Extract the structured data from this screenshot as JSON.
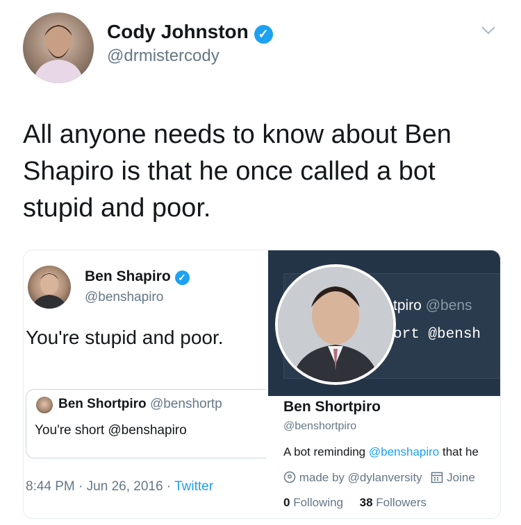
{
  "author": {
    "name": "Cody Johnston",
    "handle": "@drmistercody",
    "verified_icon": "verified-badge-icon"
  },
  "tweet": {
    "text": "All anyone needs to know about Ben Shapiro is that he once called a bot stupid and poor."
  },
  "embedded_tweet": {
    "name": "Ben Shapiro",
    "handle": "@benshapiro",
    "text": "You're stupid and poor.",
    "quoted": {
      "name": "Ben Shortpiro",
      "handle": "@benshortp",
      "text": "You're short @benshapiro"
    },
    "time": "8:44 PM",
    "date": "Jun 26, 2016",
    "source": "Twitter",
    "sep": " · "
  },
  "profile": {
    "banner_line1_name": "tpiro",
    "banner_line1_handle": "@bens",
    "banner_line2_name": "ort",
    "banner_line2_handle": "@bensh",
    "name": "Ben Shortpiro",
    "handle": "@benshortpiro",
    "bio_prefix": "A bot reminding ",
    "bio_link": "@benshapiro",
    "bio_suffix": " that he",
    "location": "made by @dylanversity",
    "joined": "Joine",
    "following_count": "0",
    "following_label": "Following",
    "followers_count": "38",
    "followers_label": "Followers"
  },
  "colors": {
    "accent": "#1da1f2",
    "secondary_text": "#657786",
    "banner": "#243447"
  }
}
